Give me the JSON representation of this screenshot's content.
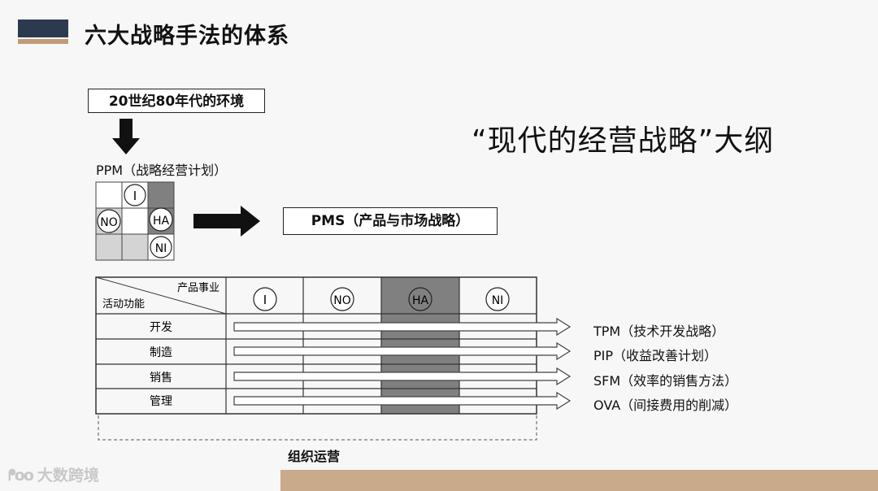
{
  "page_title": "六大战略手法的体系",
  "env_box": "20世纪80年代的环境",
  "outline_title": "“现代的经营战略”大纲",
  "ppm_label": "PPM（战略经营计划）",
  "ppm_cells": {
    "i": "I",
    "no": "NO",
    "ha": "HA",
    "ni": "NI"
  },
  "pms_box": "PMS（产品与市场战略）",
  "table": {
    "header_top": "产品事业",
    "header_bottom": "活动功能",
    "columns": [
      "I",
      "NO",
      "HA",
      "NI"
    ],
    "rows": [
      "开发",
      "制造",
      "销售",
      "管理"
    ]
  },
  "strategies": [
    "TPM（技术开发战略）",
    "PIP（收益改善计划）",
    "SFM（效率的销售方法）",
    "OVA（间接费用的削减）"
  ],
  "org_label": "组织运营",
  "watermark": "大数跨境",
  "colors": {
    "dark_cell": "#808080",
    "light_cell": "#d4d4d4",
    "logo_navy": "#2c3a4f",
    "logo_tan": "#c19b76",
    "band_tan": "#c9aa8b"
  }
}
